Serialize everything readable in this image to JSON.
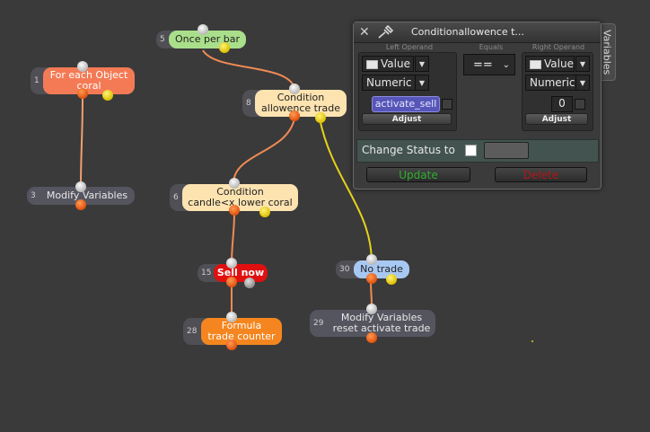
{
  "nodes": {
    "once_per_bar": {
      "num": "5",
      "line1": "Once per bar"
    },
    "for_each": {
      "num": "1",
      "line1": "For each Object",
      "line2": "coral"
    },
    "condition_allowence": {
      "num": "8",
      "line1": "Condition",
      "line2": "allowence trade"
    },
    "modify_vars3": {
      "num": "3",
      "line1": "Modify Variables"
    },
    "condition_candle": {
      "num": "6",
      "line1": "Condition",
      "line2": "candle<x lower coral"
    },
    "sell_now": {
      "num": "15",
      "line1": "Sell now"
    },
    "no_trade": {
      "num": "30",
      "line1": "No trade"
    },
    "formula": {
      "num": "28",
      "line1": "Formula",
      "line2": "trade counter"
    },
    "modify_vars29": {
      "num": "29",
      "line1": "Modify Variables",
      "line2": "reset activate trade"
    }
  },
  "panel": {
    "title": "Conditionallowence t...",
    "side_tab": "Variables",
    "left_operand_label": "Left Operand",
    "equals_label": "Equals",
    "right_operand_label": "Right Operand",
    "left": {
      "type": "Value",
      "format": "Numeric",
      "variable": "activate_sell",
      "adjust": "Adjust"
    },
    "operator": "==",
    "right": {
      "type": "Value",
      "format": "Numeric",
      "value": "0",
      "adjust": "Adjust"
    },
    "change_status_label": "Change Status to",
    "update_label": "Update",
    "delete_label": "Delete"
  },
  "colors": {
    "background": "#3a3a3a",
    "node_orange": "#f47a55",
    "node_cream": "#fde3b0",
    "node_green": "#a9df8a",
    "node_red": "#e01010",
    "node_blue": "#a8c8f4",
    "node_formula": "#f5861f",
    "node_grey": "#555560",
    "wire_orange": "#f08a55",
    "wire_yellow": "#e6d21a",
    "wire_white": "#eeeeee",
    "update_text": "#2fae2f",
    "delete_text": "#b01818"
  }
}
